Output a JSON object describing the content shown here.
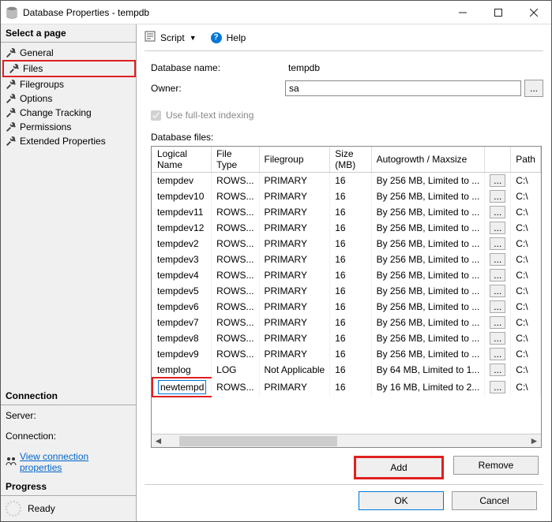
{
  "window": {
    "title": "Database Properties - tempdb"
  },
  "left": {
    "select_page": "Select a page",
    "pages": [
      {
        "label": "General"
      },
      {
        "label": "Files",
        "highlight": true
      },
      {
        "label": "Filegroups"
      },
      {
        "label": "Options"
      },
      {
        "label": "Change Tracking"
      },
      {
        "label": "Permissions"
      },
      {
        "label": "Extended Properties"
      }
    ],
    "connection_header": "Connection",
    "server_label": "Server:",
    "connection_label": "Connection:",
    "view_conn_link": "View connection properties",
    "progress_header": "Progress",
    "ready_label": "Ready"
  },
  "toolbar": {
    "script": "Script",
    "help": "Help"
  },
  "form": {
    "db_name_label": "Database name:",
    "db_name_value": "tempdb",
    "owner_label": "Owner:",
    "owner_value": "sa",
    "fulltext_label": "Use full-text indexing"
  },
  "files": {
    "label": "Database files:",
    "headers": {
      "logical": "Logical Name",
      "filetype": "File Type",
      "filegroup": "Filegroup",
      "size": "Size (MB)",
      "autogrowth": "Autogrowth / Maxsize",
      "path": "Path"
    },
    "rows": [
      {
        "logical": "tempdev",
        "filetype": "ROWS...",
        "filegroup": "PRIMARY",
        "size": "16",
        "auto": "By 256 MB, Limited to ...",
        "path": "C:\\"
      },
      {
        "logical": "tempdev10",
        "filetype": "ROWS...",
        "filegroup": "PRIMARY",
        "size": "16",
        "auto": "By 256 MB, Limited to ...",
        "path": "C:\\"
      },
      {
        "logical": "tempdev11",
        "filetype": "ROWS...",
        "filegroup": "PRIMARY",
        "size": "16",
        "auto": "By 256 MB, Limited to ...",
        "path": "C:\\"
      },
      {
        "logical": "tempdev12",
        "filetype": "ROWS...",
        "filegroup": "PRIMARY",
        "size": "16",
        "auto": "By 256 MB, Limited to ...",
        "path": "C:\\"
      },
      {
        "logical": "tempdev2",
        "filetype": "ROWS...",
        "filegroup": "PRIMARY",
        "size": "16",
        "auto": "By 256 MB, Limited to ...",
        "path": "C:\\"
      },
      {
        "logical": "tempdev3",
        "filetype": "ROWS...",
        "filegroup": "PRIMARY",
        "size": "16",
        "auto": "By 256 MB, Limited to ...",
        "path": "C:\\"
      },
      {
        "logical": "tempdev4",
        "filetype": "ROWS...",
        "filegroup": "PRIMARY",
        "size": "16",
        "auto": "By 256 MB, Limited to ...",
        "path": "C:\\"
      },
      {
        "logical": "tempdev5",
        "filetype": "ROWS...",
        "filegroup": "PRIMARY",
        "size": "16",
        "auto": "By 256 MB, Limited to ...",
        "path": "C:\\"
      },
      {
        "logical": "tempdev6",
        "filetype": "ROWS...",
        "filegroup": "PRIMARY",
        "size": "16",
        "auto": "By 256 MB, Limited to ...",
        "path": "C:\\"
      },
      {
        "logical": "tempdev7",
        "filetype": "ROWS...",
        "filegroup": "PRIMARY",
        "size": "16",
        "auto": "By 256 MB, Limited to ...",
        "path": "C:\\"
      },
      {
        "logical": "tempdev8",
        "filetype": "ROWS...",
        "filegroup": "PRIMARY",
        "size": "16",
        "auto": "By 256 MB, Limited to ...",
        "path": "C:\\"
      },
      {
        "logical": "tempdev9",
        "filetype": "ROWS...",
        "filegroup": "PRIMARY",
        "size": "16",
        "auto": "By 256 MB, Limited to ...",
        "path": "C:\\"
      },
      {
        "logical": "templog",
        "filetype": "LOG",
        "filegroup": "Not Applicable",
        "size": "16",
        "auto": "By 64 MB, Limited to 1...",
        "path": "C:\\"
      }
    ],
    "edit_row": {
      "logical": "newtempdev",
      "filetype": "ROWS...",
      "filegroup": "PRIMARY",
      "size": "16",
      "auto": "By 16 MB, Limited to 2...",
      "path": "C:\\"
    }
  },
  "actions": {
    "add": "Add",
    "remove": "Remove"
  },
  "footer": {
    "ok": "OK",
    "cancel": "Cancel"
  }
}
